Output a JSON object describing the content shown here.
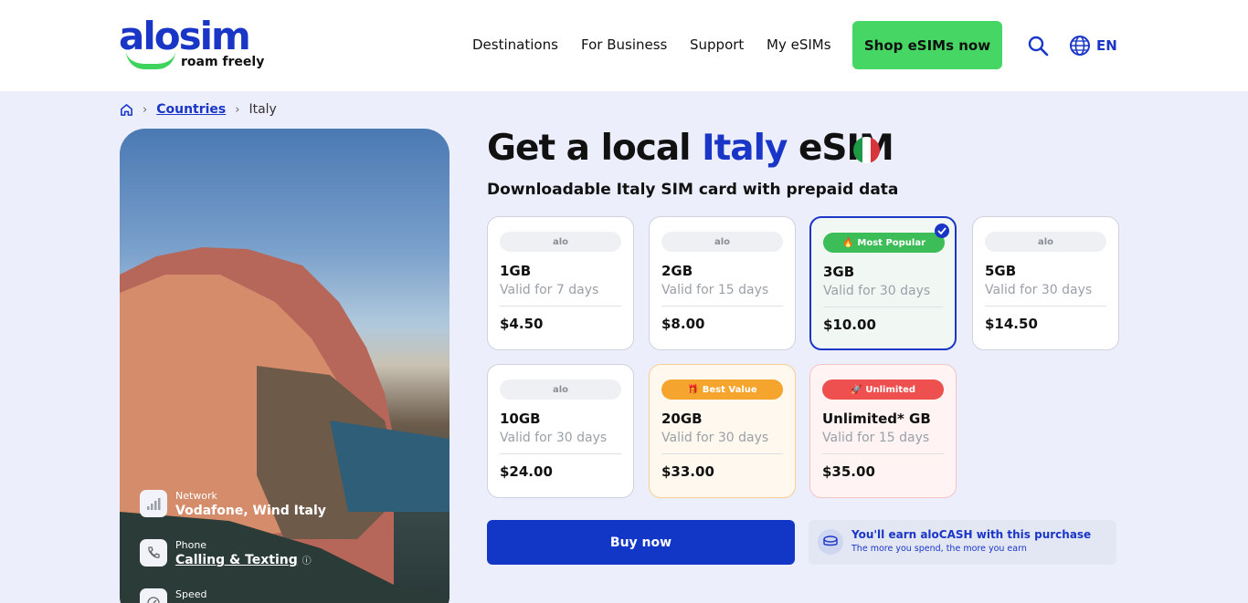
{
  "header": {
    "logo": {
      "word": "alosim",
      "tagline": "roam freely"
    },
    "nav": [
      "Destinations",
      "For Business",
      "Support",
      "My eSIMs"
    ],
    "cta": "Shop eSIMs now",
    "language": "EN"
  },
  "breadcrumb": {
    "link": "Countries",
    "current": "Italy"
  },
  "title": {
    "prefix": "Get a local ",
    "country": "Italy",
    "suffix": " eSIM"
  },
  "subtitle": "Downloadable Italy SIM card with prepaid data",
  "plans": [
    {
      "badge": "alo",
      "data": "1GB",
      "validity": "Valid for 7 days",
      "price": "$4.50"
    },
    {
      "badge": "alo",
      "data": "2GB",
      "validity": "Valid for 15 days",
      "price": "$8.00"
    },
    {
      "badge": "Most Popular",
      "data": "3GB",
      "validity": "Valid for 30 days",
      "price": "$10.00",
      "selected": true
    },
    {
      "badge": "alo",
      "data": "5GB",
      "validity": "Valid for 30 days",
      "price": "$14.50"
    },
    {
      "badge": "alo",
      "data": "10GB",
      "validity": "Valid for 30 days",
      "price": "$24.00"
    },
    {
      "badge": "Best Value",
      "data": "20GB",
      "validity": "Valid for 30 days",
      "price": "$33.00"
    },
    {
      "badge": "Unlimited",
      "data": "Unlimited* GB",
      "validity": "Valid for 15 days",
      "price": "$35.00"
    }
  ],
  "features": [
    {
      "label": "Network",
      "value": "Vodafone, Wind Italy"
    },
    {
      "label": "Phone",
      "value": "Calling & Texting"
    },
    {
      "label": "Speed",
      "value": ""
    }
  ],
  "buy": "Buy now",
  "earn": {
    "title": "You'll earn aloCASH with this purchase",
    "sub": "The more you spend, the more you earn"
  },
  "colors": {
    "brand": "#1a36c7",
    "cta": "#45d663",
    "popular": "#3cbd57",
    "best": "#f5a42d",
    "unlimited": "#ee4f4f"
  }
}
